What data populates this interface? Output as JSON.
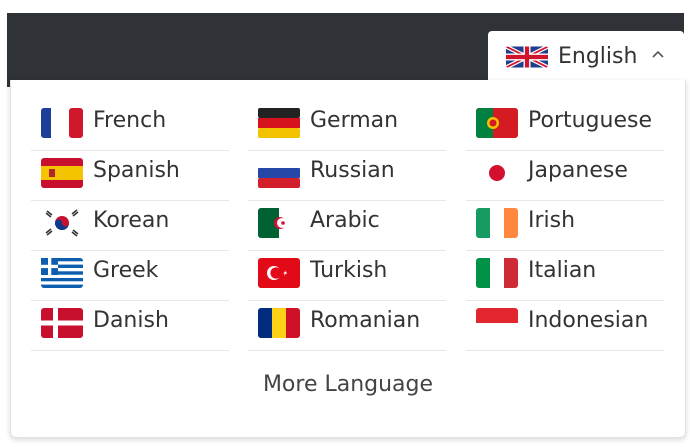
{
  "header": {
    "current_language": "English",
    "current_flag": "uk-flag-icon"
  },
  "languages": [
    {
      "label": "French",
      "flag": "france-flag-icon"
    },
    {
      "label": "German",
      "flag": "germany-flag-icon"
    },
    {
      "label": "Portuguese",
      "flag": "portugal-flag-icon"
    },
    {
      "label": "Spanish",
      "flag": "spain-flag-icon"
    },
    {
      "label": "Russian",
      "flag": "russia-flag-icon"
    },
    {
      "label": "Japanese",
      "flag": "japan-flag-icon"
    },
    {
      "label": "Korean",
      "flag": "korea-flag-icon"
    },
    {
      "label": "Arabic",
      "flag": "algeria-flag-icon"
    },
    {
      "label": "Irish",
      "flag": "ireland-flag-icon"
    },
    {
      "label": "Greek",
      "flag": "greece-flag-icon"
    },
    {
      "label": "Turkish",
      "flag": "turkey-flag-icon"
    },
    {
      "label": "Italian",
      "flag": "italy-flag-icon"
    },
    {
      "label": "Danish",
      "flag": "denmark-flag-icon"
    },
    {
      "label": "Romanian",
      "flag": "romania-flag-icon"
    },
    {
      "label": "Indonesian",
      "flag": "indonesia-flag-icon"
    }
  ],
  "more_label": "More Language"
}
